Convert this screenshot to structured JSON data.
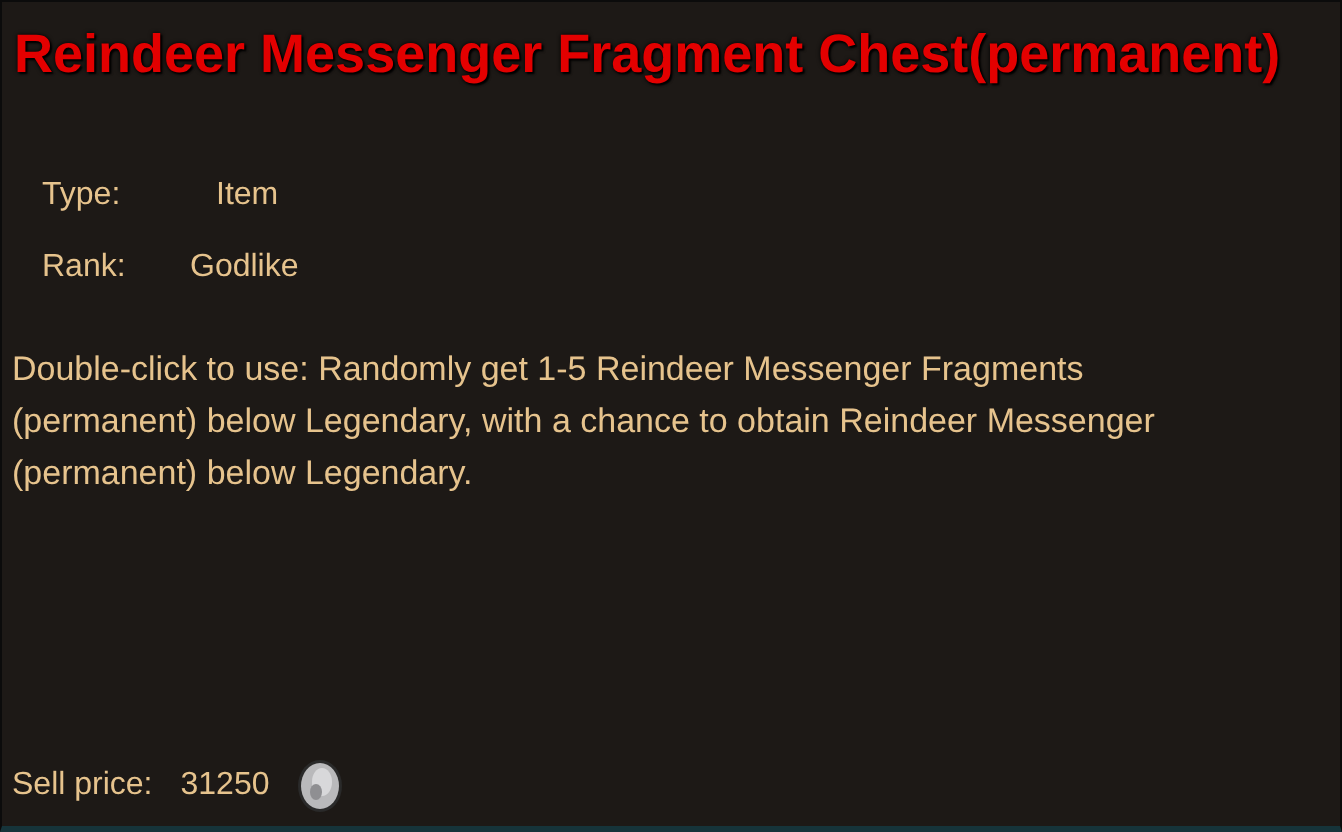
{
  "title": "Reindeer Messenger Fragment Chest(permanent)",
  "properties": [
    {
      "label": "Type:",
      "value": "Item"
    },
    {
      "label": "Rank:",
      "value": "Godlike"
    }
  ],
  "description": "Double-click to use: Randomly get 1-5 Reindeer Messenger Fragments (permanent) below Legendary, with a chance to obtain Reindeer Messenger (permanent) below Legendary.",
  "sell_price": {
    "label": "Sell price:",
    "value": "31250"
  }
}
